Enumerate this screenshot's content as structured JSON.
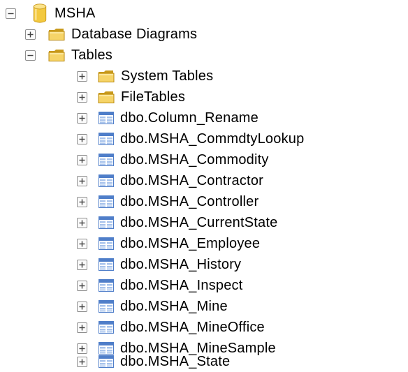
{
  "tree": {
    "database": {
      "label": "MSHA",
      "icon": "database-icon",
      "expanded": true
    },
    "database_diagrams": {
      "label": "Database Diagrams",
      "icon": "folder-icon",
      "expanded": false
    },
    "tables": {
      "label": "Tables",
      "icon": "folder-icon",
      "expanded": true,
      "folders": [
        {
          "label": "System Tables",
          "icon": "folder-icon",
          "expanded": false
        },
        {
          "label": "FileTables",
          "icon": "folder-icon",
          "expanded": false
        }
      ],
      "items": [
        {
          "label": "dbo.Column_Rename",
          "icon": "table-icon"
        },
        {
          "label": "dbo.MSHA_CommdtyLookup",
          "icon": "table-icon"
        },
        {
          "label": "dbo.MSHA_Commodity",
          "icon": "table-icon"
        },
        {
          "label": "dbo.MSHA_Contractor",
          "icon": "table-icon"
        },
        {
          "label": "dbo.MSHA_Controller",
          "icon": "table-icon"
        },
        {
          "label": "dbo.MSHA_CurrentState",
          "icon": "table-icon"
        },
        {
          "label": "dbo.MSHA_Employee",
          "icon": "table-icon"
        },
        {
          "label": "dbo.MSHA_History",
          "icon": "table-icon"
        },
        {
          "label": "dbo.MSHA_Inspect",
          "icon": "table-icon"
        },
        {
          "label": "dbo.MSHA_Mine",
          "icon": "table-icon"
        },
        {
          "label": "dbo.MSHA_MineOffice",
          "icon": "table-icon"
        },
        {
          "label": "dbo.MSHA_MineSample",
          "icon": "table-icon"
        },
        {
          "label": "dbo.MSHA_State",
          "icon": "table-icon"
        }
      ]
    }
  },
  "colors": {
    "folder": "#e8c04a",
    "folder_dark": "#c99a1c",
    "database": "#f3c93f",
    "table_header": "#4f7ec9",
    "table_cells": "#a9c4ec",
    "toggle_border": "#8d8d8d"
  }
}
